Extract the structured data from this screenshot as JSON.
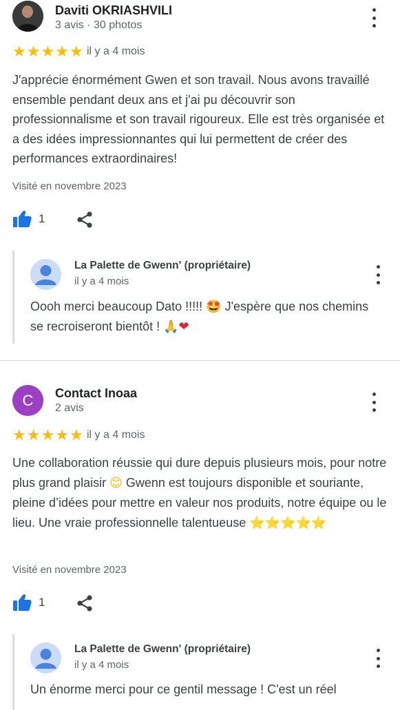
{
  "reviews": [
    {
      "author": "Daviti OKRIASHVILI",
      "meta": "3 avis · 30 photos",
      "rating": 5,
      "date": "il y a 4 mois",
      "text": "J'apprécie énormément Gwen et son travail. Nous avons travaillé ensemble pendant deux ans et j'ai pu découvrir son professionnalisme et son travail rigoureux. Elle est très organisée et a des idées impressionnantes qui lui permettent de créer des performances extraordinaires!",
      "visited": "Visité en novembre 2023",
      "likes": "1",
      "reply": {
        "author": "La Palette de Gwenn' (propriétaire)",
        "date": "il y a 4 mois",
        "text_part1": "Oooh merci beaucoup Dato !!!!!",
        "emoji1": "🤩",
        "text_part2": "J'espère que nos chemins se recroiseront bientôt !",
        "emoji2": "🙏",
        "emoji3": "❤"
      }
    },
    {
      "author": "Contact Inoaa",
      "avatar_letter": "C",
      "meta": "2 avis",
      "rating": 5,
      "date": "il y a 4 mois",
      "text_part1": "Une collaboration réussie qui dure depuis plusieurs mois, pour notre plus grand plaisir",
      "emoji1": "😊",
      "text_part2": "Gwenn est toujours disponible et souriante, pleine d’idées pour mettre en valeur nos produits, notre équipe ou le lieu. Une vraie professionnelle talentueuse",
      "emoji_stars": "⭐⭐⭐⭐⭐",
      "visited": "Visité en novembre 2023",
      "likes": "1",
      "reply": {
        "author": "La Palette de Gwenn' (propriétaire)",
        "date": "il y a 4 mois",
        "text": "Un énorme merci pour ce gentil message ! C'est un réel"
      }
    }
  ],
  "icons": {
    "star": "★",
    "like": "thumbs-up-icon",
    "share": "share-icon",
    "more": "more-vert-icon"
  },
  "colors": {
    "star": "#fbbc04",
    "like": "#1a73e8",
    "avatar_letter_bg": "#9c3fc2",
    "owner_avatar_bg": "#c9dcf8"
  }
}
